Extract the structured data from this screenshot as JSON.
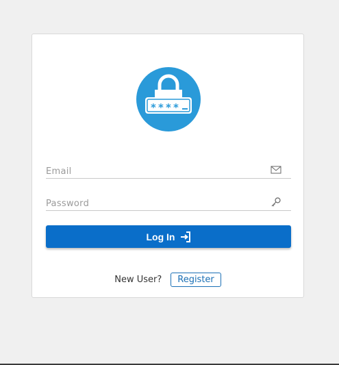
{
  "login_form": {
    "logo_icon": "lock-password-icon",
    "email": {
      "placeholder": "Email",
      "value": "",
      "icon": "envelope-icon"
    },
    "password": {
      "placeholder": "Password",
      "value": "",
      "icon": "key-icon"
    },
    "login_button": {
      "label": "Log In",
      "icon": "sign-in-icon"
    },
    "footer": {
      "new_user_text": "New User?",
      "register_label": "Register"
    }
  },
  "colors": {
    "page_background": "#f0f0f0",
    "card_background": "#ffffff",
    "logo_circle": "#2a9ad9",
    "primary_button": "#0a6ec9",
    "register_border": "#1a6fb5"
  }
}
